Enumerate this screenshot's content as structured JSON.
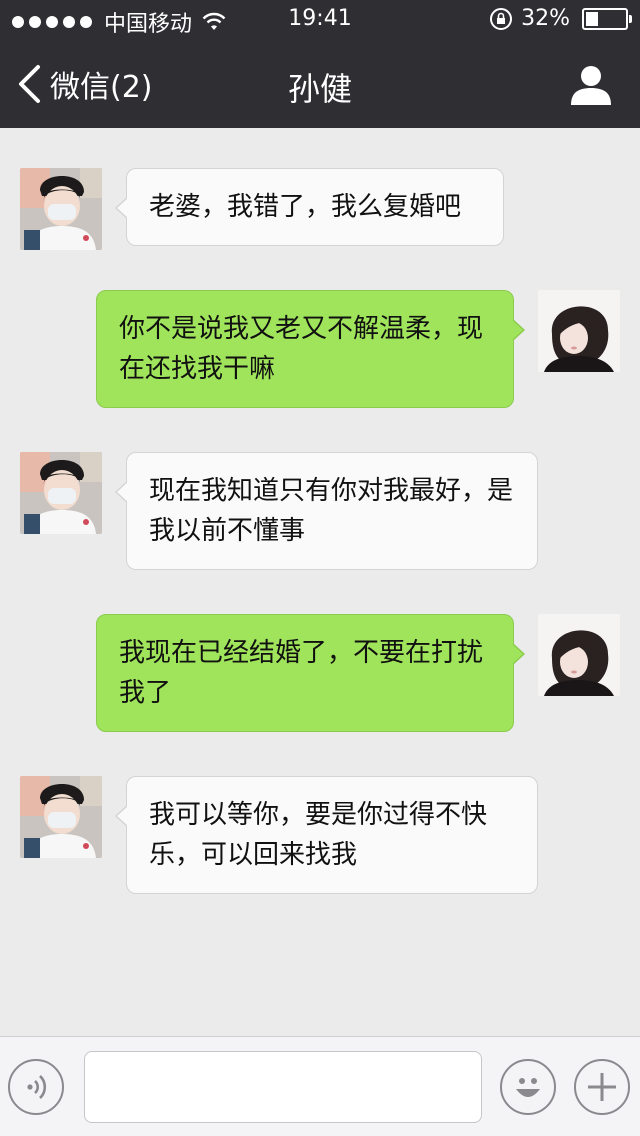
{
  "status_bar": {
    "carrier": "中国移动",
    "time": "19:41",
    "battery_text": "32%",
    "battery_level": 0.32,
    "signal_dots": 5,
    "icons": [
      "wifi-icon",
      "rotation-lock-icon",
      "battery-icon"
    ]
  },
  "nav": {
    "back_label": "微信(2)",
    "title": "孙健",
    "icons": [
      "back-chevron-icon",
      "profile-icon"
    ]
  },
  "messages": [
    {
      "side": "in",
      "avatar": "male-avatar",
      "text": "老婆，我错了，我么复婚吧"
    },
    {
      "side": "out",
      "avatar": "female-avatar",
      "text": "你不是说我又老又不解温柔，现在还找我干嘛"
    },
    {
      "side": "in",
      "avatar": "male-avatar",
      "text": "现在我知道只有你对我最好，是我以前不懂事"
    },
    {
      "side": "out",
      "avatar": "female-avatar",
      "text": "我现在已经结婚了，不要在打扰我了"
    },
    {
      "side": "in",
      "avatar": "male-avatar",
      "text": "我可以等你，要是你过得不快乐，可以回来找我"
    }
  ],
  "input_bar": {
    "text_value": "",
    "icons": [
      "voice-icon",
      "emoji-icon",
      "plus-icon"
    ]
  },
  "colors": {
    "bar_bg": "#2e2e33",
    "chat_bg": "#ebebeb",
    "incoming_bubble": "#fafafa",
    "outgoing_bubble": "#9fe45a"
  }
}
